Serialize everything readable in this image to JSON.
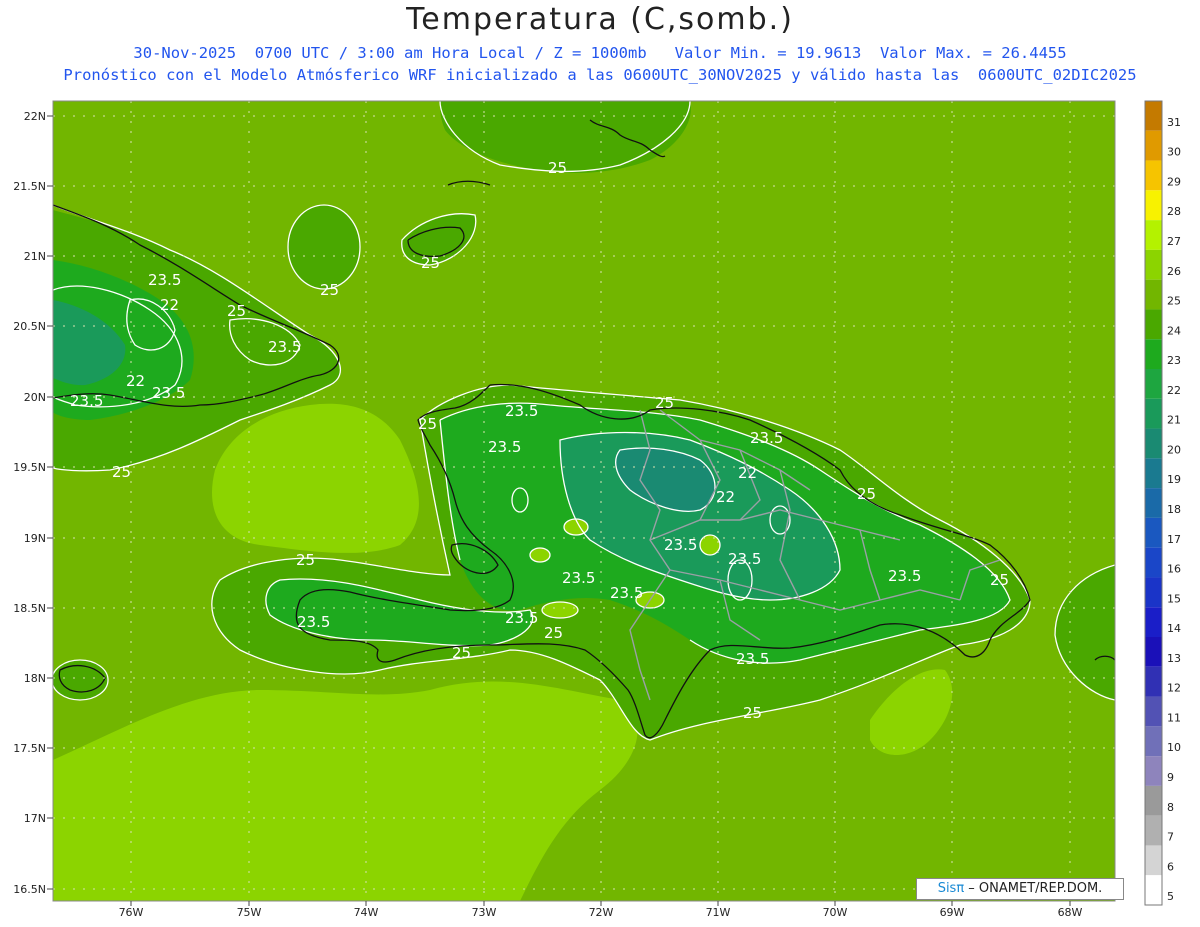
{
  "title": "Temperatura (C,somb.)",
  "subtitle_line1": "30-Nov-2025  0700 UTC / 3:00 am Hora Local / Z = 1000mb   Valor Min. = 19.9613  Valor Max. = 26.4455",
  "subtitle_line2": "Pronóstico con el Modelo Atmósferico WRF inicializado a las 0600UTC_30NOV2025 y válido hasta las  0600UTC_02DIC2025",
  "lat_labels": [
    "22N",
    "21.5N",
    "21N",
    "20.5N",
    "20N",
    "19.5N",
    "19N",
    "18.5N",
    "18N",
    "17.5N",
    "17N",
    "16.5N"
  ],
  "lon_labels": [
    "76W",
    "75W",
    "74W",
    "73W",
    "72W",
    "71W",
    "70W",
    "69W",
    "68W"
  ],
  "colorbar_labels": [
    "31",
    "30",
    "29",
    "28",
    "27",
    "26",
    "25",
    "24",
    "23",
    "22",
    "21",
    "20",
    "19",
    "18",
    "17",
    "16",
    "15",
    "14",
    "13",
    "12",
    "11",
    "10",
    "9",
    "8",
    "7",
    "6",
    "5"
  ],
  "colorbar_colors": [
    "#c47a00",
    "#e09a00",
    "#f6c400",
    "#f8f200",
    "#b4f200",
    "#8cd400",
    "#72b600",
    "#4aa800",
    "#1eaa1e",
    "#1ea640",
    "#1a9a5a",
    "#1a8a72",
    "#1a7a90",
    "#1a6aa8",
    "#1a58c0",
    "#1a46c8",
    "#1a34c8",
    "#1a1ec8",
    "#1a10b8",
    "#3030b4",
    "#5252b4",
    "#7070b8",
    "#8e84bc",
    "#9a9a9a",
    "#b0b0b0",
    "#d4d4d4",
    "#ffffff"
  ],
  "contour_labels": {
    "c25": "25",
    "c235": "23.5",
    "c22": "22"
  },
  "credit": {
    "brand": "Sisπ",
    "text": " – ONAMET/REP.DOM."
  }
}
